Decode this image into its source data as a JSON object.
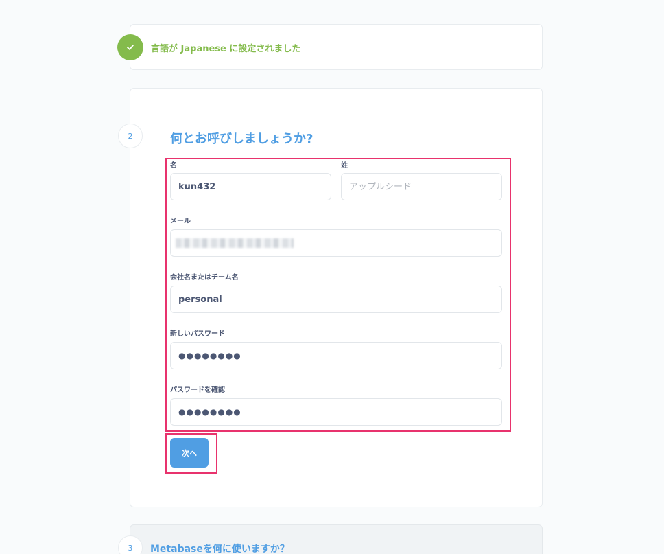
{
  "step1": {
    "title": "言語が Japanese に設定されました"
  },
  "step2": {
    "number": "2",
    "title": "何とお呼びしましょうか?",
    "fields": {
      "first_name": {
        "label": "名",
        "value": "kun432"
      },
      "last_name": {
        "label": "姓",
        "value": "",
        "placeholder": "アップルシード"
      },
      "email": {
        "label": "メール",
        "value": ""
      },
      "company": {
        "label": "会社名またはチーム名",
        "value": "personal"
      },
      "password": {
        "label": "新しいパスワード",
        "value": "●●●●●●●●"
      },
      "password_confirm": {
        "label": "パスワードを確認",
        "value": "●●●●●●●●"
      }
    },
    "next_label": "次へ"
  },
  "step3": {
    "number": "3",
    "title": "Metabaseを何に使いますか？"
  },
  "colors": {
    "accent": "#509ee3",
    "success": "#84bb4c",
    "highlight": "#e8336d"
  },
  "icons": {
    "done": "check-icon"
  }
}
